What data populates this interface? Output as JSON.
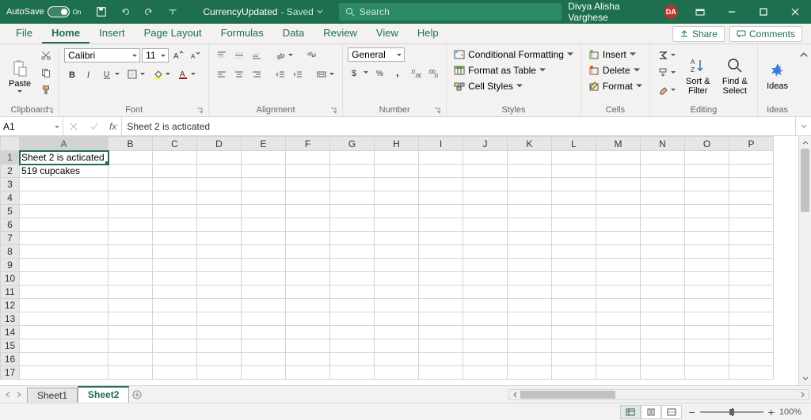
{
  "titlebar": {
    "autosave_label": "AutoSave",
    "autosave_state": "On",
    "doc_name": "CurrencyUpdated",
    "doc_status": " - Saved",
    "search_placeholder": "Search",
    "username": "Divya Alisha Varghese",
    "user_initials": "DA"
  },
  "tabs": {
    "items": [
      "File",
      "Home",
      "Insert",
      "Page Layout",
      "Formulas",
      "Data",
      "Review",
      "View",
      "Help"
    ],
    "active_index": 1,
    "share": "Share",
    "comments": "Comments"
  },
  "ribbon": {
    "clipboard": {
      "paste": "Paste",
      "label": "Clipboard"
    },
    "font": {
      "name": "Calibri",
      "size": "11",
      "label": "Font"
    },
    "alignment": {
      "label": "Alignment"
    },
    "number": {
      "format": "General",
      "label": "Number"
    },
    "styles": {
      "cond": "Conditional Formatting",
      "table": "Format as Table",
      "cell": "Cell Styles",
      "label": "Styles"
    },
    "cells": {
      "insert": "Insert",
      "delete": "Delete",
      "format": "Format",
      "label": "Cells"
    },
    "editing": {
      "sort": "Sort & Filter",
      "find": "Find & Select",
      "label": "Editing"
    },
    "ideas": {
      "btn": "Ideas",
      "label": "Ideas"
    }
  },
  "formula_bar": {
    "cell_ref": "A1",
    "content": "Sheet 2 is acticated"
  },
  "grid": {
    "columns": [
      "A",
      "B",
      "C",
      "D",
      "E",
      "F",
      "G",
      "H",
      "I",
      "J",
      "K",
      "L",
      "M",
      "N",
      "O",
      "P"
    ],
    "row_count": 17,
    "selected": {
      "row": 1,
      "col": "A"
    },
    "cells": {
      "A1": "Sheet 2 is acticated",
      "A2": "519 cupcakes"
    }
  },
  "sheets": {
    "items": [
      "Sheet1",
      "Sheet2"
    ],
    "active_index": 1
  },
  "statusbar": {
    "zoom": "100%"
  }
}
